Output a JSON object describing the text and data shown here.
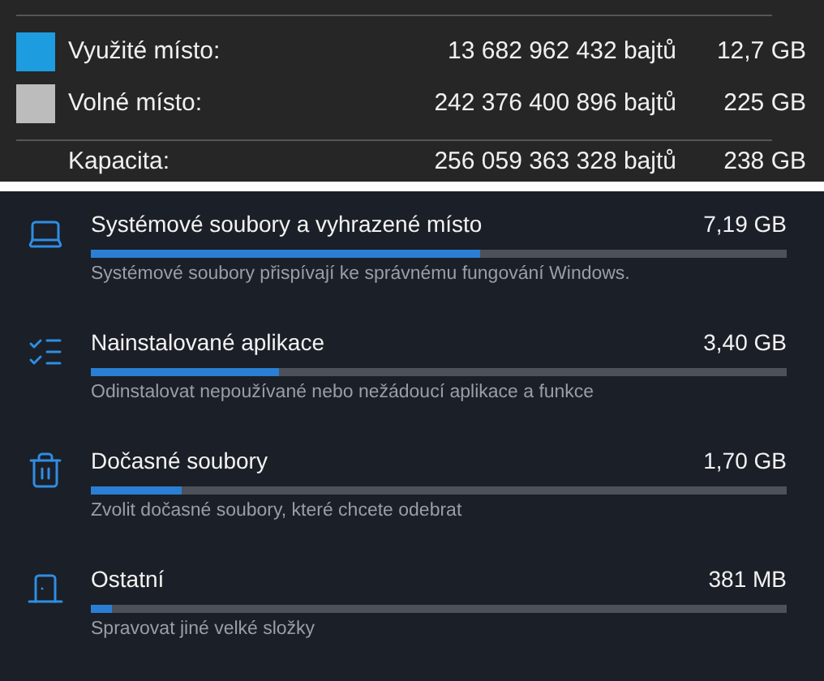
{
  "disk_summary": {
    "rows": [
      {
        "label": "Využité místo:",
        "bytes": "13 682 962 432 bajtů",
        "size": "12,7 GB",
        "color": "#1e9ce0"
      },
      {
        "label": "Volné místo:",
        "bytes": "242 376 400 896 bajtů",
        "size": "225 GB",
        "color": "#bcbcbc"
      }
    ],
    "capacity": {
      "label": "Kapacita:",
      "bytes": "256 059 363 328 bajtů",
      "size": "238 GB"
    }
  },
  "storage_categories": [
    {
      "kind": "system",
      "title": "Systémové soubory a vyhrazené místo",
      "size": "7,19 GB",
      "level": 0.56,
      "description": "Systémové soubory přispívají ke správnému fungování Windows."
    },
    {
      "kind": "apps",
      "title": "Nainstalované aplikace",
      "size": "3,40 GB",
      "level": 0.27,
      "description": "Odinstalovat nepoužívané nebo nežádoucí aplikace a funkce"
    },
    {
      "kind": "temp",
      "title": "Dočasné soubory",
      "size": "1,70 GB",
      "level": 0.13,
      "description": "Zvolit dočasné soubory, které chcete odebrat"
    },
    {
      "kind": "other",
      "title": "Ostatní",
      "size": "381 MB",
      "level": 0.03,
      "description": "Spravovat jiné velké složky"
    }
  ]
}
